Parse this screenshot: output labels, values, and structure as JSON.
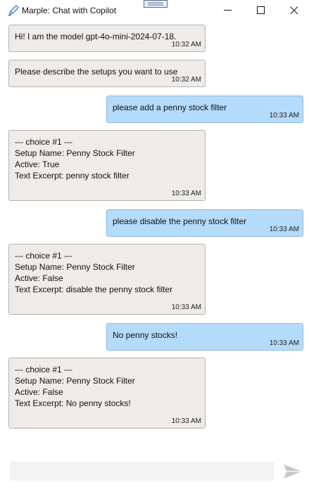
{
  "window": {
    "title": "Marple: Chat with Copilot"
  },
  "messages": [
    {
      "role": "bot",
      "text": "Hi! I am the model gpt-4o-mini-2024-07-18.",
      "time": "10:32 AM"
    },
    {
      "role": "bot",
      "text": "Please describe the setups you want to use",
      "time": "10:32 AM"
    },
    {
      "role": "user",
      "text": "please add a penny stock filter",
      "time": "10:33 AM"
    },
    {
      "role": "bot",
      "text": "--- choice #1 ---\nSetup Name: Penny Stock Filter\nActive: True\nText Excerpt: penny stock filter",
      "time": "10:33 AM"
    },
    {
      "role": "user",
      "text": "please disable the penny stock filter",
      "time": "10:33 AM"
    },
    {
      "role": "bot",
      "text": "--- choice #1 ---\nSetup Name: Penny Stock Filter\nActive: False\nText Excerpt: disable the penny stock filter",
      "time": "10:33 AM"
    },
    {
      "role": "user",
      "text": "No penny stocks!",
      "time": "10:33 AM"
    },
    {
      "role": "bot",
      "text": "--- choice #1 ---\nSetup Name: Penny Stock Filter\nActive: False\nText Excerpt: No penny stocks!",
      "time": "10:33 AM"
    }
  ],
  "input": {
    "value": "",
    "placeholder": ""
  },
  "icons": {
    "app": "pen-icon",
    "send": "send-icon",
    "minimize": "minimize-icon",
    "maximize": "maximize-icon",
    "close": "close-icon"
  },
  "colors": {
    "bot_bubble": "#eeebe8",
    "user_bubble": "#b5dbfa",
    "input_background": "#f3f3f3",
    "send_icon": "#c8c8c8"
  }
}
